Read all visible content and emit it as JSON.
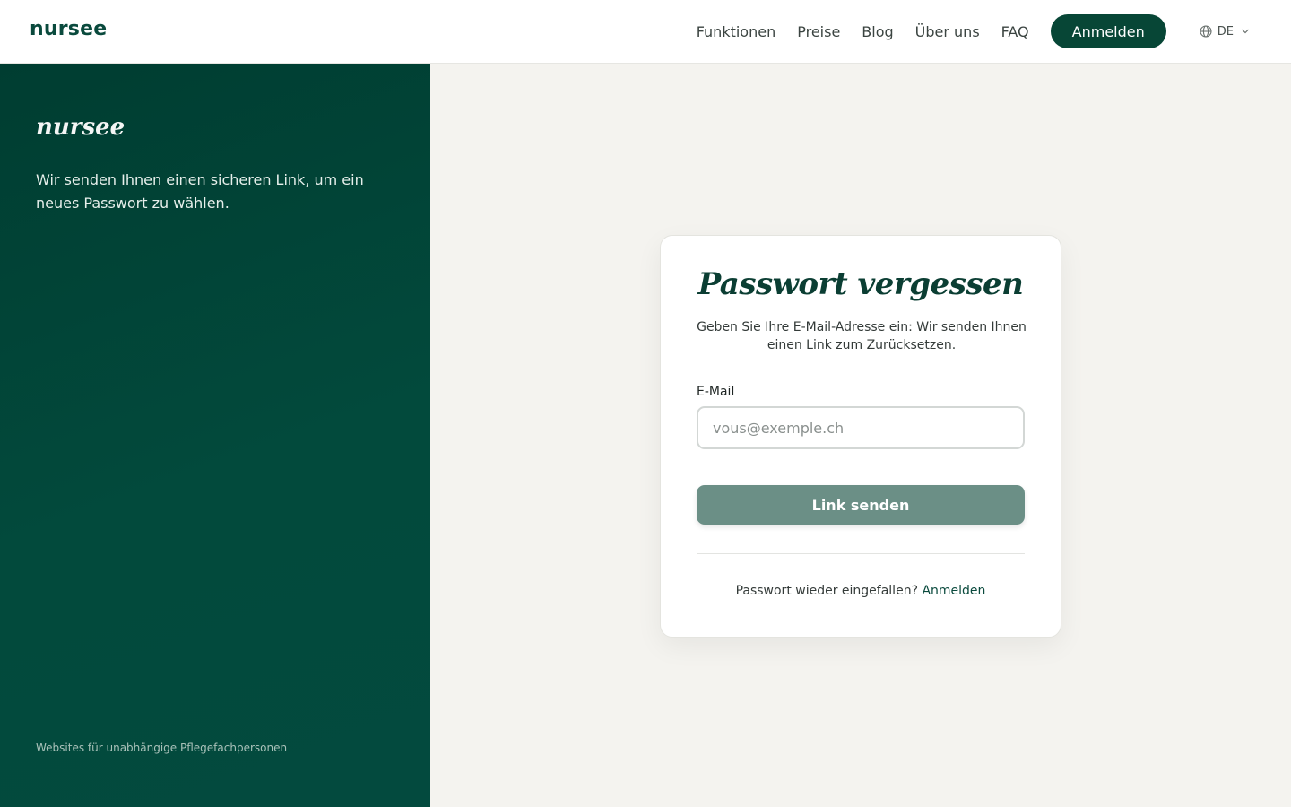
{
  "header": {
    "brand": "nursee",
    "nav": [
      "Funktionen",
      "Preise",
      "Blog",
      "Über uns",
      "FAQ"
    ],
    "cta": "Anmelden",
    "lang": {
      "icon": "globe-icon",
      "code": "DE",
      "dropdown_icon": "chevron-down-icon"
    }
  },
  "side": {
    "logo": "nursee",
    "message": "Wir senden Ihnen einen sicheren Link, um ein neues Passwort zu wählen.",
    "footer": "Websites für unabhängige Pflegefachpersonen"
  },
  "card": {
    "title": "Passwort vergessen",
    "subtitle": "Geben Sie Ihre E-Mail-Adresse ein: Wir senden Ihnen einen Link zum Zurücksetzen.",
    "email_label": "E-Mail",
    "email_placeholder": "vous@exemple.ch",
    "email_value": "",
    "submit_label": "Link senden",
    "footer_text": "Passwort wieder eingefallen?",
    "footer_link": "Anmelden"
  },
  "colors": {
    "brand_green": "#074636",
    "panel_green": "#013f33",
    "button_disabled": "#6b8f86",
    "page_bg": "#f4f3ef"
  }
}
